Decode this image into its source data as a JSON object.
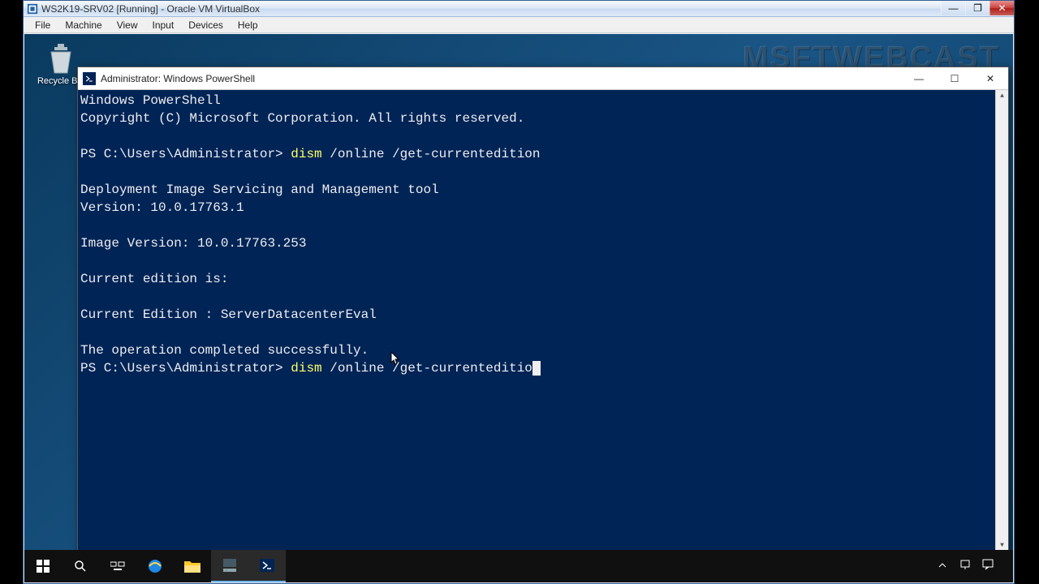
{
  "host_window": {
    "title": "WS2K19-SRV02 [Running] - Oracle VM VirtualBox",
    "menu": {
      "file": "File",
      "machine": "Machine",
      "view": "View",
      "input": "Input",
      "devices": "Devices",
      "help": "Help"
    }
  },
  "guest": {
    "watermark": "MSFTWEBCAST",
    "desktop": {
      "recycle_bin_label": "Recycle Bin"
    }
  },
  "powershell": {
    "title": "Administrator: Windows PowerShell",
    "lines": {
      "l1": "Windows PowerShell",
      "l2": "Copyright (C) Microsoft Corporation. All rights reserved.",
      "l3": "",
      "prompt1_prefix": "PS C:\\Users\\Administrator> ",
      "prompt1_cmd": "dism",
      "prompt1_args": " /online /get-currentedition",
      "l5": "",
      "l6": "Deployment Image Servicing and Management tool",
      "l7": "Version: 10.0.17763.1",
      "l8": "",
      "l9": "Image Version: 10.0.17763.253",
      "l10": "",
      "l11": "Current edition is:",
      "l12": "",
      "l13": "Current Edition : ServerDatacenterEval",
      "l14": "",
      "l15": "The operation completed successfully.",
      "prompt2_prefix": "PS C:\\Users\\Administrator> ",
      "prompt2_cmd": "dism",
      "prompt2_args": " /online /get-currenteditio"
    }
  },
  "icons": {
    "min_glyph": "—",
    "max_glyph": "☐",
    "close_glyph": "✕",
    "restore_glyph": "❐"
  }
}
